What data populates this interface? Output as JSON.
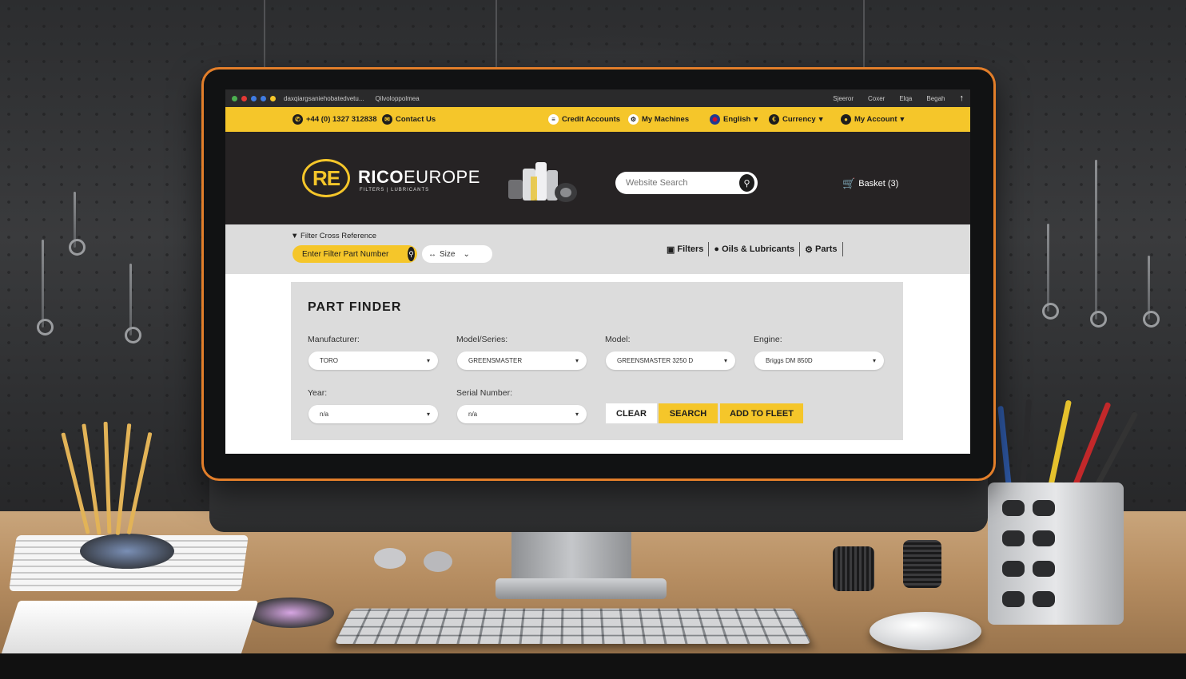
{
  "browser": {
    "address": "daxqiargsaniehobatedvetu...",
    "tab": "Qilvoloppolmea",
    "right_items": [
      "Sjeeror",
      "Coxer",
      "Elqa",
      "Begah"
    ]
  },
  "topbar": {
    "phone": "+44 (0) 1327 312838",
    "contact": "Contact Us",
    "credit_accounts": "Credit Accounts",
    "my_machines": "My Machines",
    "language": "English",
    "currency": "Currency",
    "account": "My Account"
  },
  "header": {
    "logo_mark": "RE",
    "brand_bold": "RICO",
    "brand_rest": "EUROPE",
    "tagline": "FILTERS | LUBRICANTS",
    "search_placeholder": "Website Search",
    "basket": "Basket (3)"
  },
  "subnav": {
    "filter_title": "Filter Cross Reference",
    "part_placeholder": "Enter Filter Part Number",
    "size_label": "Size",
    "categories": [
      {
        "label": "Filters",
        "icon": "filter-icon"
      },
      {
        "label": "Oils & Lubricants",
        "icon": "oil-drop-icon"
      },
      {
        "label": "Parts",
        "icon": "parts-icon"
      }
    ]
  },
  "part_finder": {
    "title": "PART FINDER",
    "fields": [
      {
        "label": "Manufacturer:",
        "value": "TORO"
      },
      {
        "label": "Model/Series:",
        "value": "GREENSMASTER"
      },
      {
        "label": "Model:",
        "value": "GREENSMASTER 3250 D"
      },
      {
        "label": "Engine:",
        "value": "Briggs DM 850D"
      },
      {
        "label": "Year:",
        "value": "n/a"
      },
      {
        "label": "Serial Number:",
        "value": "n/a"
      }
    ],
    "buttons": {
      "clear": "CLEAR",
      "search": "SEARCH",
      "fleet": "ADD TO FLEET"
    }
  },
  "colors": {
    "accent": "#f5c62a",
    "dark": "#262324",
    "panel": "#dcdcdc"
  }
}
